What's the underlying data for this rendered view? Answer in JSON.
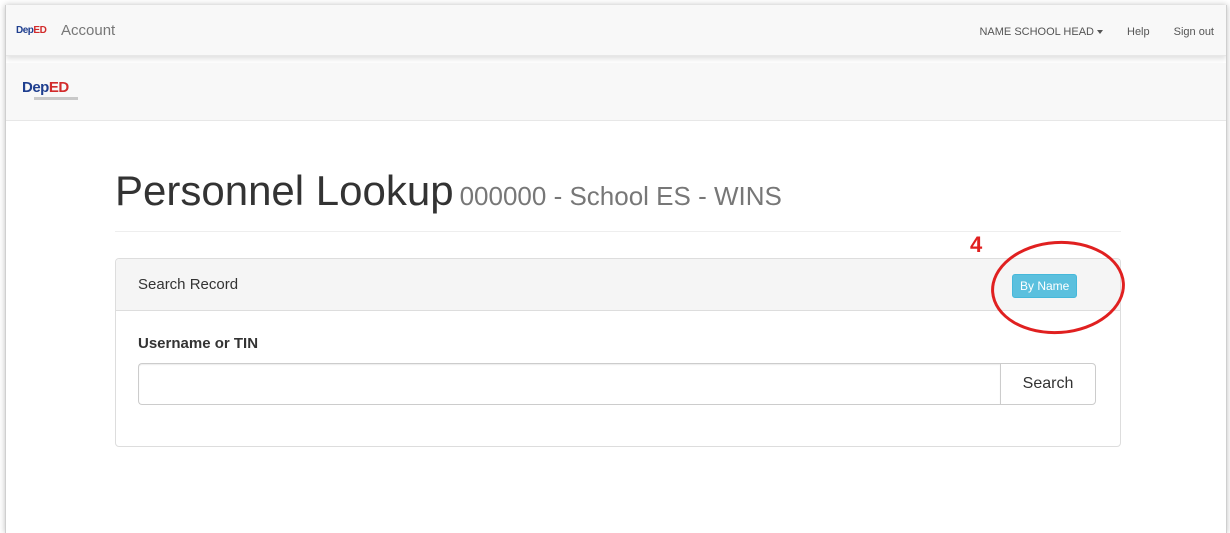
{
  "topbar": {
    "logo_text_a": "Dep",
    "logo_text_b": "ED",
    "brand": "Account",
    "user_menu": "NAME SCHOOL HEAD",
    "help": "Help",
    "sign_out": "Sign out"
  },
  "subbar": {
    "logo_text_a": "Dep",
    "logo_text_b": "ED"
  },
  "header": {
    "title": "Personnel Lookup",
    "subtitle": "000000 - School ES - WINS"
  },
  "panel": {
    "heading": "Search Record",
    "mode_button": "By Name",
    "field_label": "Username or TIN",
    "search_value": "",
    "search_button": "Search"
  },
  "annotation": {
    "number": "4",
    "color": "#e02020"
  },
  "colors": {
    "info_button": "#5bc0de",
    "navbar_bg": "#f8f8f8"
  }
}
